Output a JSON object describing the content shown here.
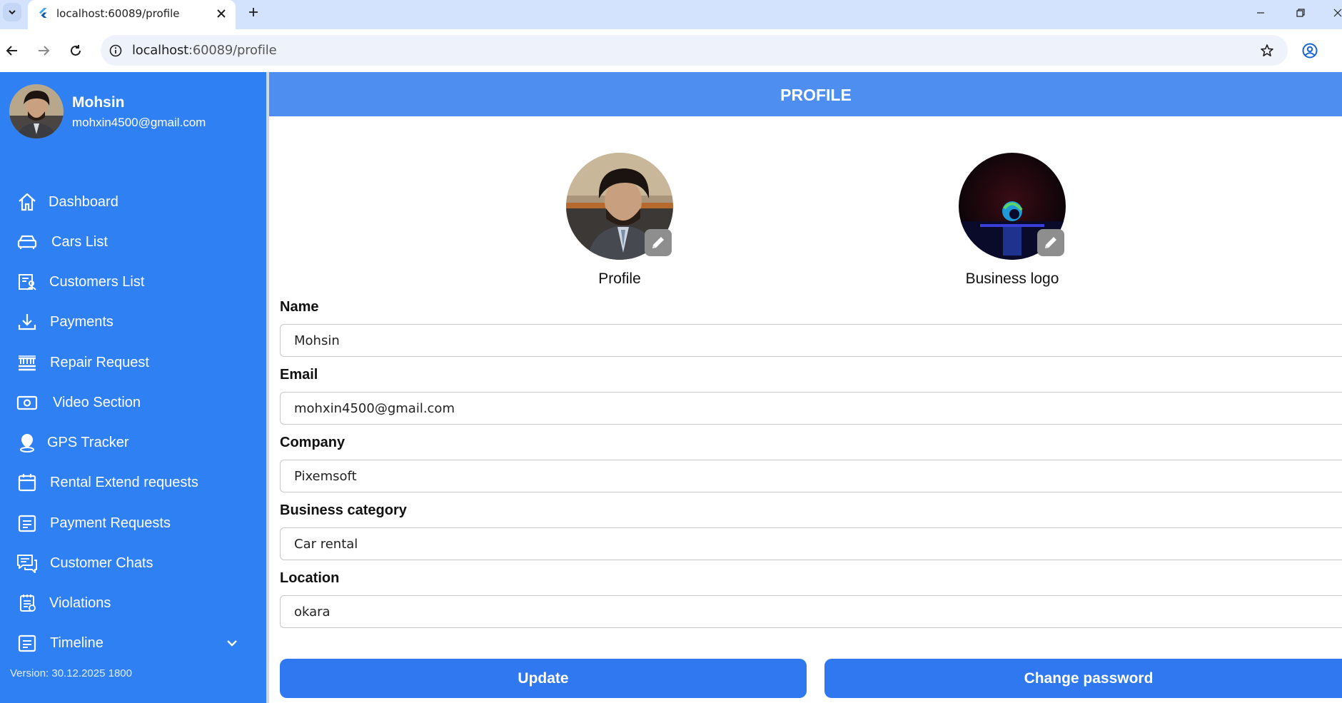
{
  "browser": {
    "tab_title": "localhost:60089/profile",
    "url_host": "localhost",
    "url_rest": ":60089/profile"
  },
  "user": {
    "name": "Mohsin",
    "email": "mohxin4500@gmail.com"
  },
  "sidebar": {
    "items": [
      {
        "label": "Dashboard",
        "icon": "home-icon"
      },
      {
        "label": "Cars List",
        "icon": "car-icon"
      },
      {
        "label": "Customers List",
        "icon": "customers-icon"
      },
      {
        "label": "Payments",
        "icon": "download-icon"
      },
      {
        "label": "Repair Request",
        "icon": "repair-icon"
      },
      {
        "label": "Video Section",
        "icon": "video-icon"
      },
      {
        "label": "GPS Tracker",
        "icon": "location-pin-icon"
      },
      {
        "label": "Rental Extend requests",
        "icon": "calendar-icon"
      },
      {
        "label": "Payment Requests",
        "icon": "document-icon"
      },
      {
        "label": "Customer Chats",
        "icon": "chat-icon"
      },
      {
        "label": "Violations",
        "icon": "violations-icon"
      },
      {
        "label": "Timeline",
        "icon": "timeline-icon"
      }
    ],
    "version": "Version: 30.12.2025 1800"
  },
  "header": {
    "title": "PROFILE"
  },
  "avatars": {
    "profile_label": "Profile",
    "logo_label": "Business logo"
  },
  "form": {
    "name_label": "Name",
    "name_value": "Mohsin",
    "email_label": "Email",
    "email_value": "mohxin4500@gmail.com",
    "company_label": "Company",
    "company_value": "Pixemsoft",
    "category_label": "Business category",
    "category_value": "Car rental",
    "location_label": "Location",
    "location_value": "okara"
  },
  "actions": {
    "update_label": "Update",
    "change_password_label": "Change password"
  },
  "colors": {
    "sidebar": "#2f80f3",
    "header": "#4d8ef0",
    "button": "#2f78f0"
  }
}
